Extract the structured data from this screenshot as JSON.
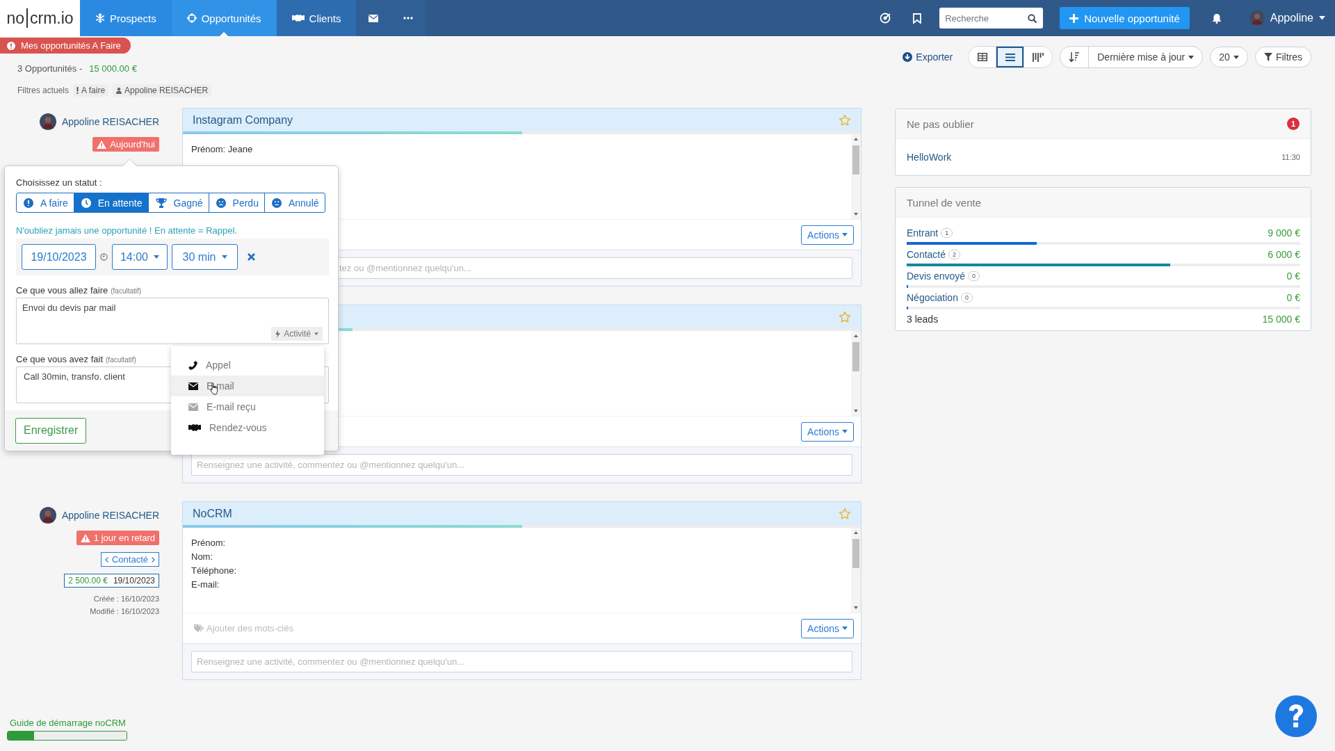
{
  "navbar": {
    "logo": {
      "left": "no",
      "right": "crm.io"
    },
    "tabs": [
      {
        "label": "Prospects",
        "color": "#2a8ae2",
        "selected": false
      },
      {
        "label": "Opportunités",
        "color": "#3193e6",
        "selected": true
      },
      {
        "label": "Clients",
        "color": "#2e6cb0",
        "selected": false
      },
      {
        "color": "#2f5f94",
        "selected": false
      },
      {
        "color": "#2f5f94",
        "selected": false
      }
    ],
    "search": {
      "placeholder": "Recherche"
    },
    "new_button": "Nouvelle opportunité",
    "user": "Appoline"
  },
  "header": {
    "alert": "Mes opportunités A Faire",
    "count": "3 Opportunités -",
    "total": "15 000.00 €",
    "filters_label": "Filtres actuels",
    "filters": [
      "A faire",
      "Appoline REISACHER"
    ]
  },
  "toolbar": {
    "export": "Exporter",
    "views": [
      {
        "selected": false
      },
      {
        "selected": true
      },
      {
        "selected": false
      }
    ],
    "sort": "Dernière mise à jour",
    "per_page": "20",
    "filters": "Filtres"
  },
  "opportunities": [
    {
      "owner": "Appoline REISACHER",
      "badge": "Aujourd'hui",
      "title": "Instagram Company",
      "level": 0.5,
      "fields": [
        "Prénom: Jeane"
      ],
      "actions": "Actions",
      "comment_placeholder": "tez ou @mentionnez quelqu'un...",
      "status_popup": true
    },
    {
      "level": 0.25,
      "actions": "Actions",
      "comment_placeholder": "Renseignez une activité, commentez ou @mentionnez quelqu'un...",
      "status_popup": false
    },
    {
      "owner": "Appoline REISACHER",
      "badge": "1 jour en retard",
      "step": "Contacté",
      "amount": "2 500.00 €",
      "date": "19/10/2023",
      "created": "Créée : 16/10/2023",
      "modified": "Modifié : 16/10/2023",
      "title": "NoCRM",
      "level": 0.5,
      "fields": [
        "Prénom:",
        "Nom:",
        "Téléphone:",
        "E-mail:"
      ],
      "tags_placeholder": "Ajouter des mots-clés",
      "actions": "Actions",
      "comment_placeholder": "Renseignez une activité, commentez ou @mentionnez quelqu'un...",
      "status_popup": false
    }
  ],
  "status_popup": {
    "label": "Choisissez un statut :",
    "statuses": [
      {
        "label": "A faire",
        "selected": false
      },
      {
        "label": "En attente",
        "selected": true
      },
      {
        "label": "Gagné",
        "selected": false
      },
      {
        "label": "Perdu",
        "selected": false
      },
      {
        "label": "Annulé",
        "selected": false
      }
    ],
    "reminder_note": "N'oubliez jamais une opportunité ! En attente = Rappel.",
    "date": "19/10/2023",
    "time": "14:00",
    "duration": "30 min",
    "next_label": "Ce que vous allez faire",
    "next_hint": "(facultatif)",
    "next_value": "Envoi du devis par mail",
    "activity_button": "Activité",
    "done_label": "Ce que vous avez fait",
    "done_hint": "(facultatif)",
    "done_value": "Call 30min, transfo. client",
    "save": "Enregistrer",
    "activity_menu": [
      {
        "label": "Appel",
        "highlighted": false
      },
      {
        "label": "E-mail",
        "highlighted": true
      },
      {
        "label": "E-mail reçu",
        "highlighted": false
      },
      {
        "label": "Rendez-vous",
        "highlighted": false
      }
    ]
  },
  "sidebar": {
    "reminders": {
      "title": "Ne pas oublier",
      "count": "1",
      "items": [
        {
          "name": "HelloWork",
          "time": "11:30"
        }
      ]
    },
    "funnel": {
      "title": "Tunnel de vente",
      "steps": [
        {
          "label": "Entrant",
          "count": "1",
          "value": "9 000 €",
          "level": 0.33,
          "color": "#1565d8"
        },
        {
          "label": "Contacté",
          "count": "2",
          "value": "6 000 €",
          "level": 0.67,
          "color": "#12899b"
        },
        {
          "label": "Devis envoyé",
          "count": "0",
          "value": "0 €",
          "level": 0
        },
        {
          "label": "Négociation",
          "count": "0",
          "value": "0 €",
          "level": 0
        }
      ],
      "total_label": "3 leads",
      "total_value": "15 000 €"
    }
  },
  "guide": {
    "label": "Guide de démarrage noCRM",
    "level": 0.22
  }
}
